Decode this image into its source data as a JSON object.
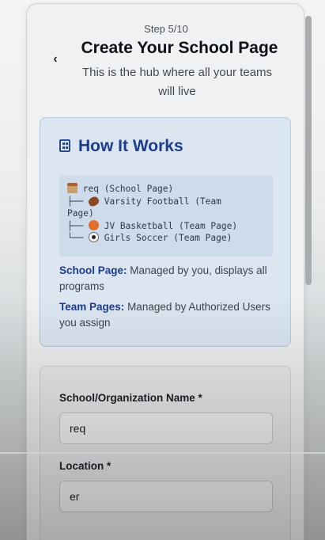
{
  "header": {
    "step": "Step 5/10",
    "title": "Create Your School Page",
    "subtitle": "This is the hub where all your teams will live"
  },
  "how_it_works": {
    "title": "How It Works",
    "icon": "building-icon",
    "tree": {
      "school": "req (School Page)",
      "teams": [
        {
          "prefix": "├── ",
          "icon": "football-icon",
          "label": "Varsity Football (Team",
          "label_wrap": "Page)"
        },
        {
          "prefix": "├── ",
          "icon": "basketball-icon",
          "label": "JV Basketball (Team Page)"
        },
        {
          "prefix": "└── ",
          "icon": "soccer-icon",
          "label": "Girls Soccer (Team Page)"
        }
      ]
    },
    "school_page": {
      "term": "School Page:",
      "text": "Managed by you, displays all programs"
    },
    "team_pages": {
      "term": "Team Pages:",
      "text": "Managed by Authorized Users you assign"
    }
  },
  "form": {
    "name_label": "School/Organization Name *",
    "name_value": "req",
    "location_label": "Location *",
    "location_value": "er"
  },
  "colors": {
    "accent": "#1d3c8f",
    "info_bg": "#dbe6f1"
  }
}
